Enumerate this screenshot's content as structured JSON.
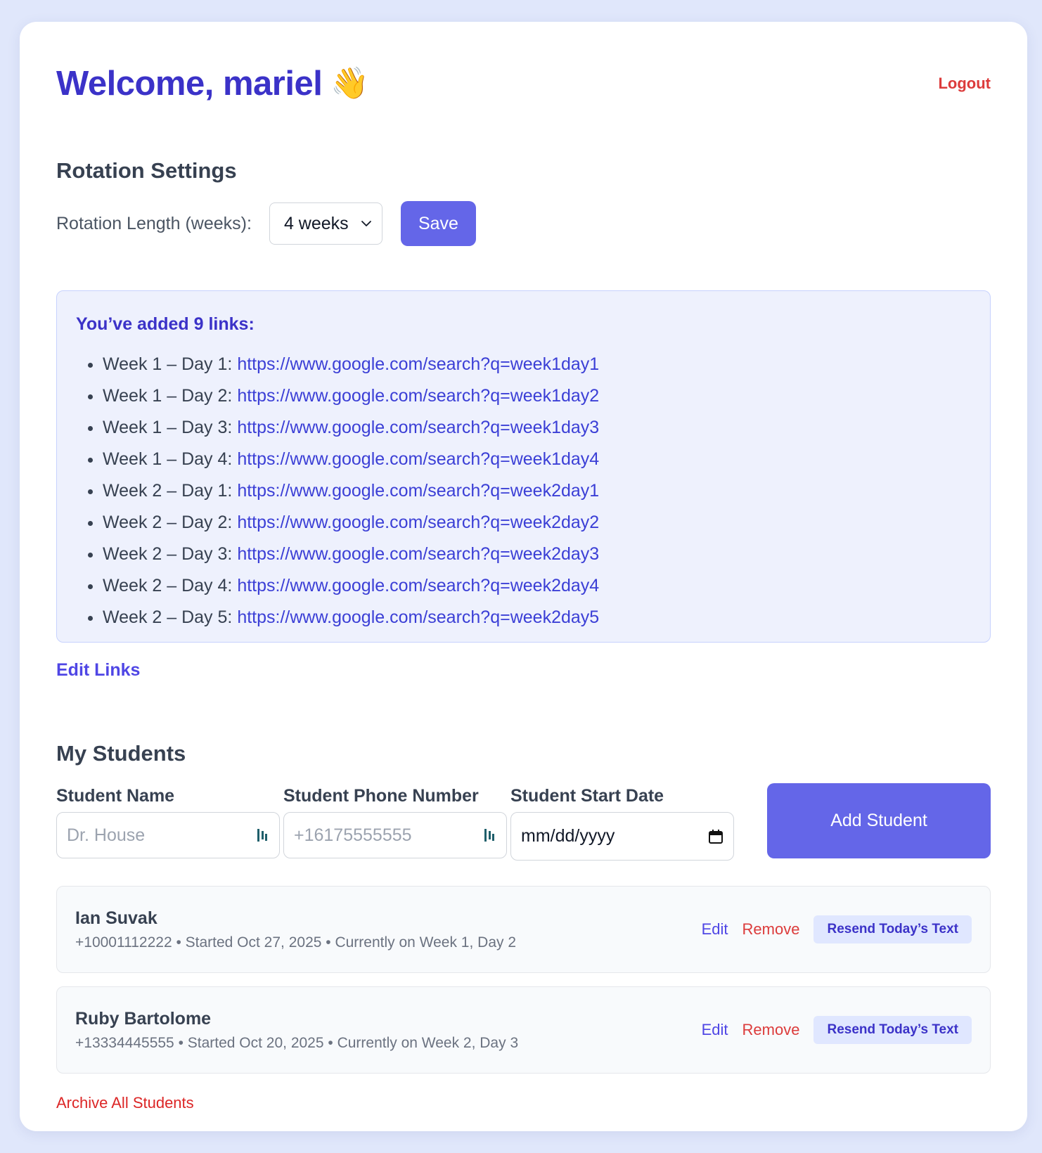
{
  "header": {
    "welcome": "Welcome, mariel",
    "wave_emoji": "👋",
    "logout_label": "Logout"
  },
  "rotation": {
    "title": "Rotation Settings",
    "length_label": "Rotation Length (weeks):",
    "selected_value": "4 weeks",
    "save_label": "Save"
  },
  "links": {
    "heading": "You’ve added 9 links:",
    "items": [
      {
        "label": "Week 1 – Day 1:",
        "url": "https://www.google.com/search?q=week1day1"
      },
      {
        "label": "Week 1 – Day 2:",
        "url": "https://www.google.com/search?q=week1day2"
      },
      {
        "label": "Week 1 – Day 3:",
        "url": "https://www.google.com/search?q=week1day3"
      },
      {
        "label": "Week 1 – Day 4:",
        "url": "https://www.google.com/search?q=week1day4"
      },
      {
        "label": "Week 2 – Day 1:",
        "url": "https://www.google.com/search?q=week2day1"
      },
      {
        "label": "Week 2 – Day 2:",
        "url": "https://www.google.com/search?q=week2day2"
      },
      {
        "label": "Week 2 – Day 3:",
        "url": "https://www.google.com/search?q=week2day3"
      },
      {
        "label": "Week 2 – Day 4:",
        "url": "https://www.google.com/search?q=week2day4"
      },
      {
        "label": "Week 2 – Day 5:",
        "url": "https://www.google.com/search?q=week2day5"
      }
    ],
    "edit_label": "Edit Links"
  },
  "students": {
    "title": "My Students",
    "form": {
      "name_label": "Student Name",
      "name_placeholder": "Dr. House",
      "phone_label": "Student Phone Number",
      "phone_placeholder": "+16175555555",
      "date_label": "Student Start Date",
      "date_value": "mm/dd/yyyy",
      "add_label": "Add Student"
    },
    "list": [
      {
        "name": "Ian Suvak",
        "meta": "+10001112222 • Started Oct 27, 2025 • Currently on Week 1, Day 2",
        "edit": "Edit",
        "remove": "Remove",
        "resend": "Resend Today’s Text"
      },
      {
        "name": "Ruby Bartolome",
        "meta": "+13334445555 • Started Oct 20, 2025 • Currently on Week 2, Day 3",
        "edit": "Edit",
        "remove": "Remove",
        "resend": "Resend Today’s Text"
      }
    ],
    "archive_label": "Archive All Students"
  },
  "colors": {
    "accent": "#6466e8",
    "heading": "#3b32c8",
    "danger": "#dc3b3b",
    "background": "#e0e7fb"
  }
}
